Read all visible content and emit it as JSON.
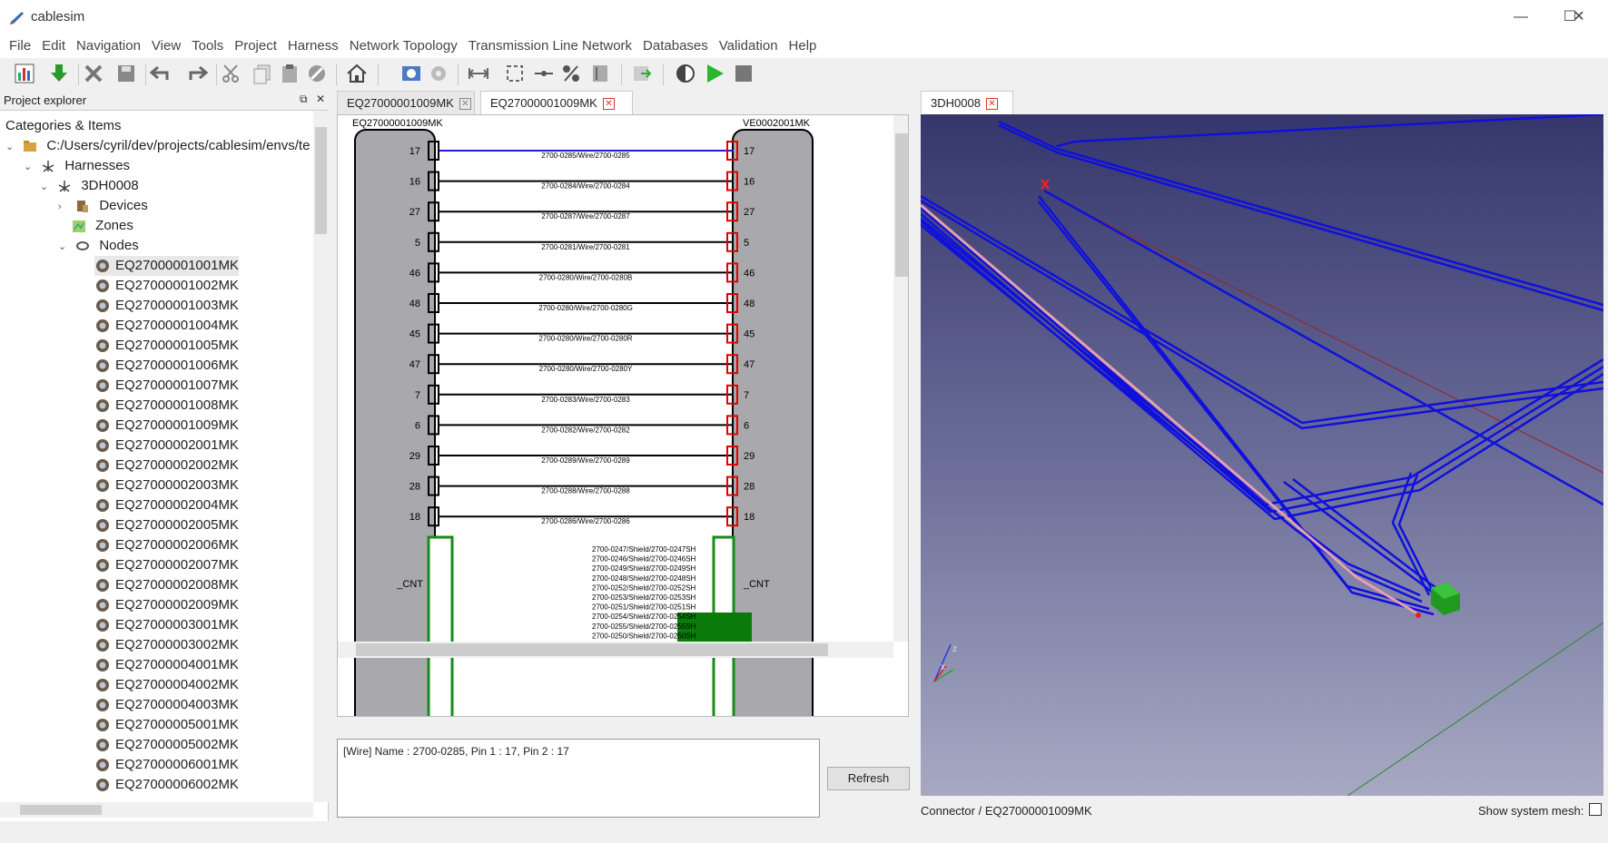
{
  "window": {
    "title": "cablesim",
    "minimize": "—",
    "maximize": "☐",
    "close": "✕"
  },
  "menu": [
    "File",
    "Edit",
    "Navigation",
    "View",
    "Tools",
    "Project",
    "Harness",
    "Network Topology",
    "Transmission Line Network",
    "Databases",
    "Validation",
    "Help"
  ],
  "explorer": {
    "title": "Project explorer",
    "float_btn": "⧉",
    "close_btn": "✕",
    "tree": {
      "root_label": "Categories & Items",
      "project_path": "C:/Users/cyril/dev/projects/cablesim/envs/te",
      "harnesses": "Harnesses",
      "harness": "3DH0008",
      "devices": "Devices",
      "zones": "Zones",
      "nodes": "Nodes",
      "node_items": [
        "EQ27000001001MK",
        "EQ27000001002MK",
        "EQ27000001003MK",
        "EQ27000001004MK",
        "EQ27000001005MK",
        "EQ27000001006MK",
        "EQ27000001007MK",
        "EQ27000001008MK",
        "EQ27000001009MK",
        "EQ27000002001MK",
        "EQ27000002002MK",
        "EQ27000002003MK",
        "EQ27000002004MK",
        "EQ27000002005MK",
        "EQ27000002006MK",
        "EQ27000002007MK",
        "EQ27000002008MK",
        "EQ27000002009MK",
        "EQ27000003001MK",
        "EQ27000003002MK",
        "EQ27000004001MK",
        "EQ27000004002MK",
        "EQ27000004003MK",
        "EQ27000005001MK",
        "EQ27000005002MK",
        "EQ27000006001MK",
        "EQ27000006002MK"
      ]
    }
  },
  "tabs": {
    "center": [
      {
        "label": "EQ27000001009MK",
        "active": false
      },
      {
        "label": "EQ27000001009MK",
        "active": true
      }
    ],
    "right": [
      {
        "label": "3DH0008",
        "active": true
      }
    ]
  },
  "schematic": {
    "left_connector": "EQ27000001009MK",
    "right_connector": "VE0002001MK",
    "wires": [
      {
        "pin": "17",
        "label": "2700-0285/Wire/2700-0285",
        "selected": true
      },
      {
        "pin": "16",
        "label": "2700-0284/Wire/2700-0284"
      },
      {
        "pin": "27",
        "label": "2700-0287/Wire/2700-0287"
      },
      {
        "pin": "5",
        "label": "2700-0281/Wire/2700-0281"
      },
      {
        "pin": "46",
        "label": "2700-0280/Wire/2700-0280B"
      },
      {
        "pin": "48",
        "label": "2700-0280/Wire/2700-0280G"
      },
      {
        "pin": "45",
        "label": "2700-0280/Wire/2700-0280R"
      },
      {
        "pin": "47",
        "label": "2700-0280/Wire/2700-0280Y"
      },
      {
        "pin": "7",
        "label": "2700-0283/Wire/2700-0283"
      },
      {
        "pin": "6",
        "label": "2700-0282/Wire/2700-0282"
      },
      {
        "pin": "29",
        "label": "2700-0289/Wire/2700-0289"
      },
      {
        "pin": "28",
        "label": "2700-0288/Wire/2700-0288"
      },
      {
        "pin": "18",
        "label": "2700-0286/Wire/2700-0286"
      }
    ],
    "shield_pin": "_CNT",
    "shields": [
      "2700-0247/Shield/2700-0247SH",
      "2700-0246/Shield/2700-0246SH",
      "2700-0249/Shield/2700-0249SH",
      "2700-0248/Shield/2700-0248SH",
      "2700-0252/Shield/2700-0252SH",
      "2700-0253/Shield/2700-0253SH",
      "2700-0251/Shield/2700-0251SH",
      "2700-0254/Shield/2700-0254SH",
      "2700-0255/Shield/2700-0255SH",
      "2700-0250/Shield/2700-0250SH"
    ]
  },
  "info": {
    "text": "[Wire] Name : 2700-0285, Pin 1 : 17, Pin 2 : 17",
    "refresh": "Refresh"
  },
  "view3d": {
    "status": "Connector / EQ27000001009MK",
    "show_mesh_label": "Show system mesh:",
    "axis_z": "z",
    "axis_x": "x"
  },
  "colors": {
    "wire_selected": "#1f1fd6",
    "pin_left": "#000000",
    "pin_right": "#e00000",
    "shield": "#1a8a1a",
    "cable_3d": "#1010dd"
  }
}
